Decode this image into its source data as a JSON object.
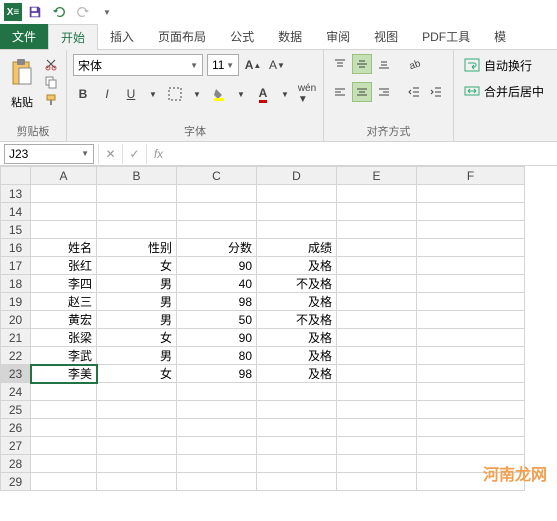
{
  "qat": {
    "app": "X≡"
  },
  "tabs": {
    "file": "文件",
    "home": "开始",
    "insert": "插入",
    "layout": "页面布局",
    "formulas": "公式",
    "data": "数据",
    "review": "审阅",
    "view": "视图",
    "pdf": "PDF工具",
    "more": "模"
  },
  "ribbon": {
    "clipboard": {
      "label": "剪贴板",
      "paste": "粘贴"
    },
    "font": {
      "label": "字体",
      "name": "宋体",
      "size": "11",
      "bold": "B",
      "italic": "I",
      "underline": "U"
    },
    "align": {
      "label": "对齐方式"
    },
    "wrap": {
      "wraptext": "自动换行",
      "merge": "合并后居中"
    }
  },
  "formula_bar": {
    "namebox": "J23",
    "fx": "fx"
  },
  "grid": {
    "cols": [
      "A",
      "B",
      "C",
      "D",
      "E",
      "F"
    ],
    "rows": [
      13,
      14,
      15,
      16,
      17,
      18,
      19,
      20,
      21,
      22,
      23,
      24,
      25,
      26,
      27,
      28,
      29
    ],
    "data": {
      "16": {
        "A": "姓名",
        "B": "性别",
        "C": "分数",
        "D": "成绩"
      },
      "17": {
        "A": "张红",
        "B": "女",
        "C": "90",
        "D": "及格"
      },
      "18": {
        "A": "李四",
        "B": "男",
        "C": "40",
        "D": "不及格"
      },
      "19": {
        "A": "赵三",
        "B": "男",
        "C": "98",
        "D": "及格"
      },
      "20": {
        "A": "黄宏",
        "B": "男",
        "C": "50",
        "D": "不及格"
      },
      "21": {
        "A": "张梁",
        "B": "女",
        "C": "90",
        "D": "及格"
      },
      "22": {
        "A": "李武",
        "B": "男",
        "C": "80",
        "D": "及格"
      },
      "23": {
        "A": "李美",
        "B": "女",
        "C": "98",
        "D": "及格"
      }
    },
    "selected": {
      "row": 23,
      "col": "A"
    }
  },
  "watermark": "河南龙网"
}
